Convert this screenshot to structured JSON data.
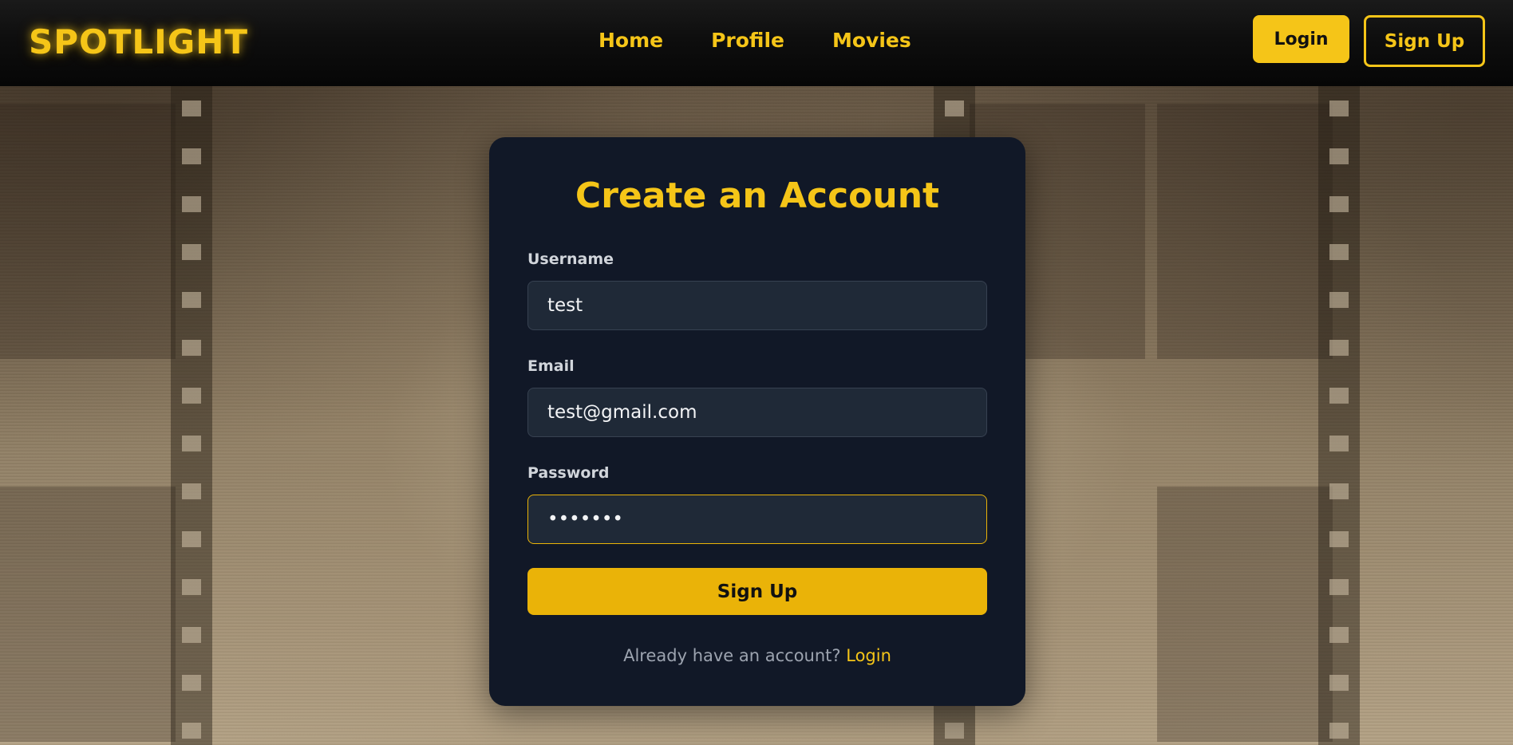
{
  "header": {
    "logo": "SPOTLIGHT",
    "nav": [
      {
        "label": "Home"
      },
      {
        "label": "Profile"
      },
      {
        "label": "Movies"
      }
    ],
    "login_label": "Login",
    "signup_label": "Sign Up"
  },
  "form": {
    "title": "Create an Account",
    "username": {
      "label": "Username",
      "value": "test"
    },
    "email": {
      "label": "Email",
      "value": "test@gmail.com"
    },
    "password": {
      "label": "Password",
      "value": "1234567"
    },
    "submit_label": "Sign Up",
    "footer_prompt": "Already have an account?",
    "footer_link": "Login"
  },
  "colors": {
    "accent": "#f5c518",
    "button": "#eab308",
    "card": "#111827",
    "input": "#1f2937"
  }
}
